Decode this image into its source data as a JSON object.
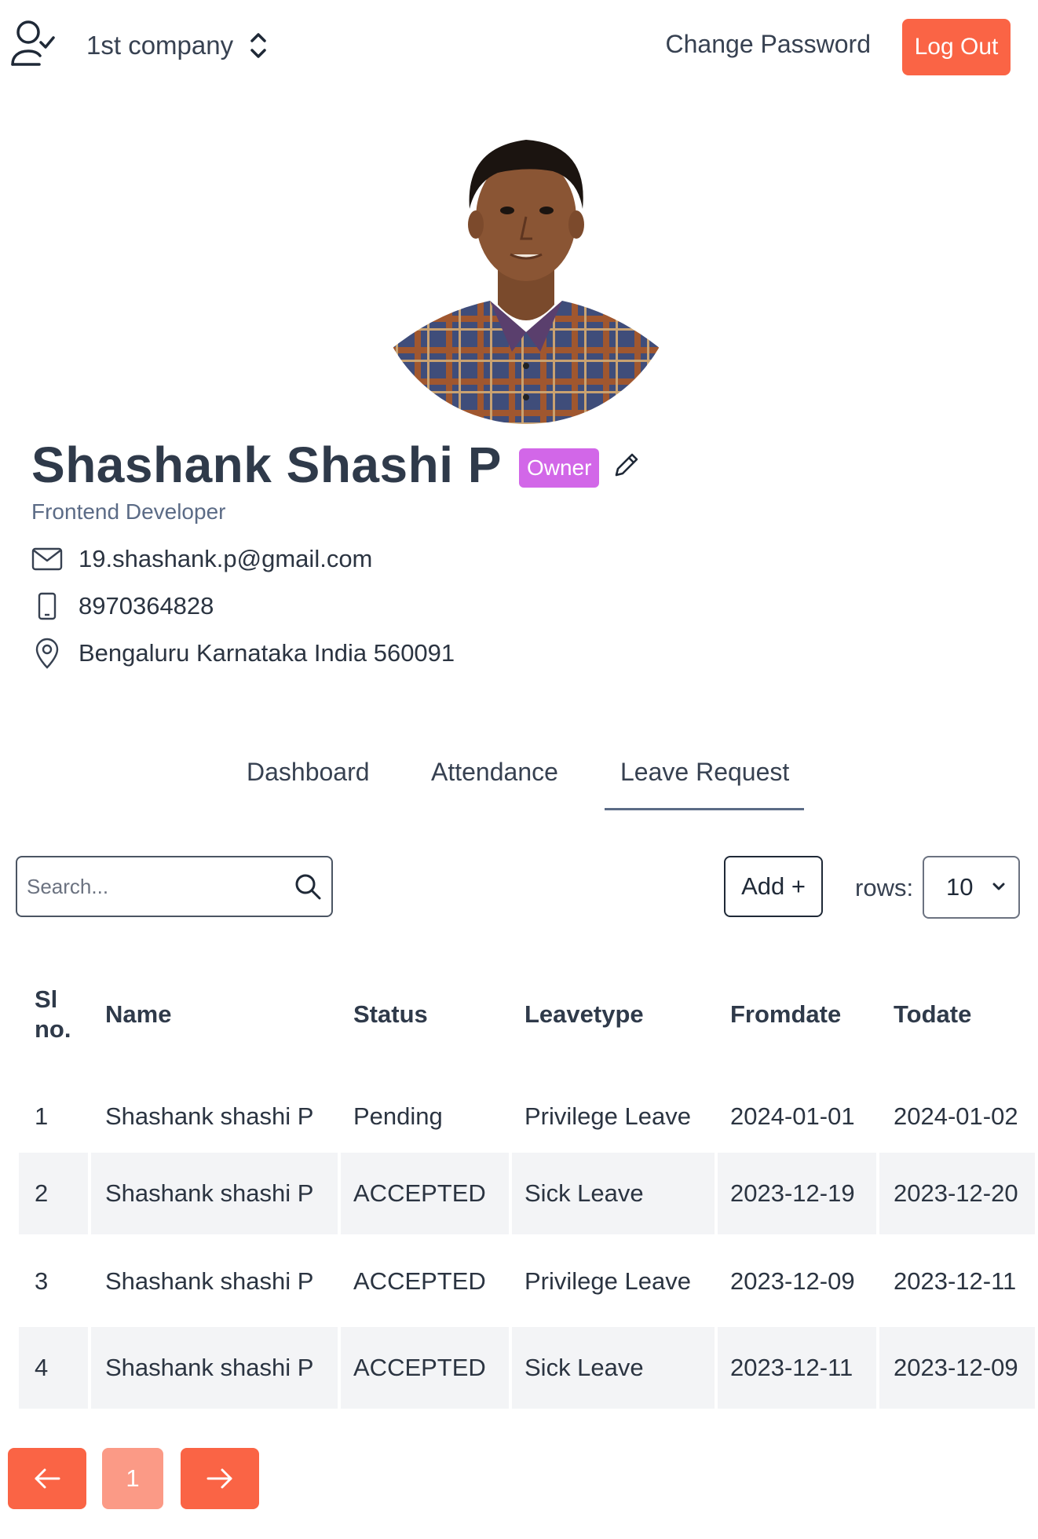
{
  "header": {
    "company_name": "1st company",
    "change_password_label": "Change Password",
    "logout_label": "Log Out"
  },
  "profile": {
    "name": "Shashank Shashi P",
    "badge": "Owner",
    "role": "Frontend Developer",
    "email": "19.shashank.p@gmail.com",
    "phone": "8970364828",
    "address": "Bengaluru Karnataka India 560091"
  },
  "tabs": [
    {
      "label": "Dashboard",
      "active": false
    },
    {
      "label": "Attendance",
      "active": false
    },
    {
      "label": "Leave Request",
      "active": true
    }
  ],
  "controls": {
    "search_placeholder": "Search...",
    "add_label": "Add +",
    "rows_label": "rows:",
    "rows_value": "10"
  },
  "table": {
    "headers": [
      "Sl no.",
      "Name",
      "Status",
      "Leavetype",
      "Fromdate",
      "Todate"
    ],
    "rows": [
      {
        "sl": "1",
        "name": "Shashank shashi P",
        "status": "Pending",
        "leavetype": "Privilege Leave",
        "fromdate": "2024-01-01",
        "todate": "2024-01-02"
      },
      {
        "sl": "2",
        "name": "Shashank shashi P",
        "status": "ACCEPTED",
        "leavetype": "Sick Leave",
        "fromdate": "2023-12-19",
        "todate": "2023-12-20"
      },
      {
        "sl": "3",
        "name": "Shashank shashi P",
        "status": "ACCEPTED",
        "leavetype": "Privilege Leave",
        "fromdate": "2023-12-09",
        "todate": "2023-12-11"
      },
      {
        "sl": "4",
        "name": "Shashank shashi P",
        "status": "ACCEPTED",
        "leavetype": "Sick Leave",
        "fromdate": "2023-12-11",
        "todate": "2023-12-09"
      }
    ]
  },
  "pagination": {
    "current_page": "1"
  },
  "colors": {
    "accent": "#fa6445",
    "badge": "#d267e8",
    "row_shade": "#f3f4f6"
  }
}
